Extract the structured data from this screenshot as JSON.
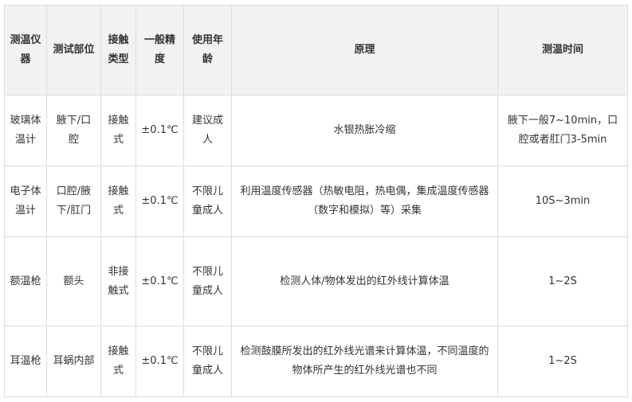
{
  "table": {
    "headers": [
      "测温仪器",
      "测试部位",
      "接触类型",
      "一般精度",
      "使用年龄",
      "原理",
      "测温时间"
    ],
    "rows": [
      [
        "玻璃体温计",
        "腋下/口腔",
        "接触式",
        "±0.1℃",
        "建议成人",
        "水银热胀冷缩",
        "腋下一般7~10min，口腔或者肛门3-5min"
      ],
      [
        "电子体温计",
        "口腔/腋下/肛门",
        "接触式",
        "±0.1℃",
        "不限儿童成人",
        "利用温度传感器（热敏电阻，热电偶，集成温度传感器（数字和模拟）等）采集",
        "10S~3min"
      ],
      [
        "额温枪",
        "额头",
        "非接触式",
        "±0.1℃",
        "不限儿童成人",
        "检测人体/物体发出的红外线计算体温",
        "1~2S"
      ],
      [
        "耳温枪",
        "耳蜗内部",
        "接触式",
        "±0.1℃",
        "不限儿童成人",
        "检测鼓膜所发出的红外线光谱来计算体温，不同温度的物体所产生的红外线光谱也不同",
        "1~2S"
      ]
    ]
  }
}
